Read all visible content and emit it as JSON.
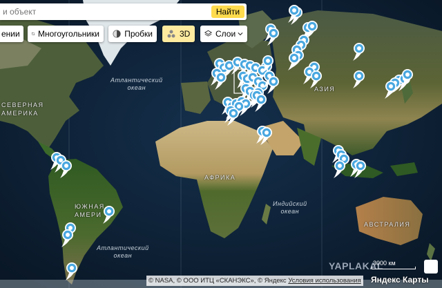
{
  "search": {
    "placeholder": "и объект",
    "button": "Найти"
  },
  "toolbar": {
    "cut_label": "ении",
    "polygons": "Многоугольники",
    "traffic": "Пробки",
    "mode3d": "3D",
    "layers": "Слои"
  },
  "labels": {
    "atlantic_north": [
      "Атлантический",
      "океан"
    ],
    "atlantic_south": [
      "Атлантический",
      "океан"
    ],
    "indian": [
      "Индийский",
      "океан"
    ],
    "north_america": [
      "СЕВЕРНАЯ",
      "АМЕРИКА"
    ],
    "south_america": [
      "ЮЖНАЯ",
      "АМЕРИ"
    ],
    "africa": "АФРИКА",
    "asia": "АЗИЯ",
    "australia": "АВСТРАЛИЯ"
  },
  "footer": {
    "copyright": "© NASA, © ООО ИТЦ «СКАНЭКС», © Яндекс",
    "terms": "Условия использования",
    "logo": "Яндекс Карты",
    "scale": "3000 км",
    "watermark": "YAPLAKAL"
  },
  "colors": {
    "ocean": "#0c1e33",
    "land": "#5a6a3c",
    "desert": "#c9b27a",
    "marker": "#4aa8e0",
    "search_button": "#ffdb4d"
  },
  "markers_count_visible": 69
}
